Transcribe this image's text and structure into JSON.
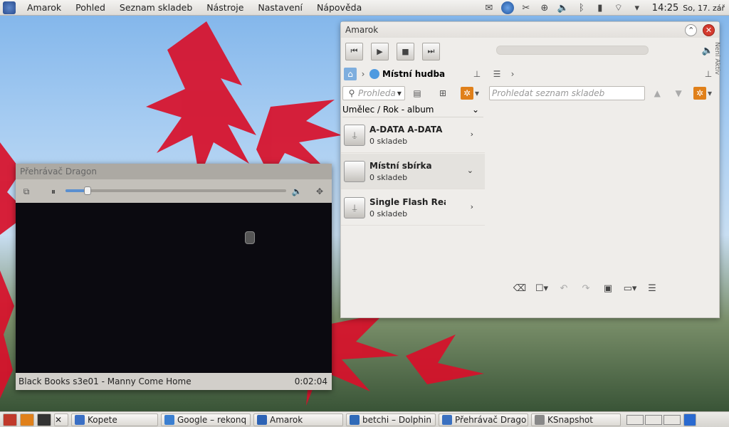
{
  "menubar": {
    "items": [
      "Amarok",
      "Pohled",
      "Seznam skladeb",
      "Nástroje",
      "Nastavení",
      "Nápověda"
    ]
  },
  "tray": {
    "icons": [
      "mail-icon",
      "network-globe-icon",
      "scissors-icon",
      "network-icon",
      "volume-icon",
      "bluetooth-icon",
      "battery-icon",
      "wifi-icon",
      "expand-tray-icon"
    ],
    "time": "14:25",
    "date": "So, 17. zář"
  },
  "amarok": {
    "title": "Amarok",
    "breadcrumb": "Místní hudba",
    "search_placeholder": "Prohledat",
    "search_visible": "Prohleda",
    "playlist_search_placeholder": "Prohledat seznam skladeb",
    "sort": "Umělec / Rok - album",
    "collections": [
      {
        "name": "A-DATA A-DATA N",
        "count": "0 skladeb",
        "chevron": "›"
      },
      {
        "name": "Místní sbírka",
        "count": "0 skladeb",
        "chevron": "⌄"
      },
      {
        "name": "Single Flash Reade",
        "count": "0 skladeb",
        "chevron": "›"
      }
    ],
    "side_text": "Není Aktiv"
  },
  "dragon": {
    "title": "Přehrávač Dragon",
    "now_playing": "Black Books s3e01 - Manny Come Home",
    "time": "0:02:04",
    "progress": 0.1
  },
  "taskbar": {
    "tasks": [
      {
        "label": "Kopete",
        "color": "#3a6fc4"
      },
      {
        "label": "Google – rekonq",
        "color": "#3b7fd0"
      },
      {
        "label": "Amarok",
        "color": "#2d63b5"
      },
      {
        "label": "betchi – Dolphin",
        "color": "#2f6ab8"
      },
      {
        "label": "Přehrávač Drago",
        "color": "#3a70c0"
      },
      {
        "label": "KSnapshot",
        "color": "#888888"
      }
    ]
  },
  "colors": {
    "leaf_red": "#d8102a",
    "close_red": "#d43a2e"
  }
}
